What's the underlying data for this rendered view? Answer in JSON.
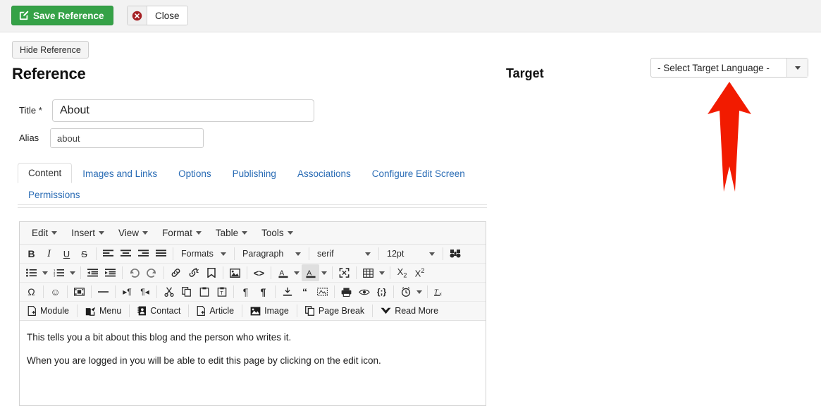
{
  "topbar": {
    "save_label": "Save Reference",
    "save_icon": "edit-square-icon",
    "close_label": "Close",
    "close_icon": "red-circle-x-icon",
    "save_color": "#35a247",
    "close_icon_color": "#a52024"
  },
  "hide_reference_label": "Hide Reference",
  "reference_heading": "Reference",
  "target_heading": "Target",
  "language_select": {
    "value": "- Select Target Language -",
    "caret_icon": "chevron-down-icon"
  },
  "annotation": {
    "arrow_icon": "up-arrow-annotation",
    "color": "#f21b00"
  },
  "form": {
    "title_label": "Title *",
    "title_value": "About",
    "title_placeholder": "Title",
    "alias_label": "Alias",
    "alias_value": "about",
    "alias_placeholder": "Alias"
  },
  "tabs": {
    "row1": [
      {
        "label": "Content",
        "active": true
      },
      {
        "label": "Images and Links",
        "active": false
      },
      {
        "label": "Options",
        "active": false
      },
      {
        "label": "Publishing",
        "active": false
      },
      {
        "label": "Associations",
        "active": false
      },
      {
        "label": "Configure Edit Screen",
        "active": false
      }
    ],
    "row2": [
      {
        "label": "Permissions",
        "active": false
      }
    ]
  },
  "editor": {
    "menubar": [
      {
        "label": "Edit"
      },
      {
        "label": "Insert"
      },
      {
        "label": "View"
      },
      {
        "label": "Format"
      },
      {
        "label": "Table"
      },
      {
        "label": "Tools"
      }
    ],
    "row1": {
      "buttons": [
        {
          "name": "bold-icon",
          "glyph": "B",
          "style": "bold"
        },
        {
          "name": "italic-icon",
          "glyph": "I",
          "style": "italic"
        },
        {
          "name": "underline-icon",
          "glyph": "U",
          "style": "underline"
        },
        {
          "name": "strikethrough-icon",
          "glyph": "S",
          "style": "strike"
        }
      ],
      "align": [
        {
          "name": "align-left-icon"
        },
        {
          "name": "align-center-icon"
        },
        {
          "name": "align-right-icon"
        },
        {
          "name": "align-justify-icon"
        }
      ],
      "formats_label": "Formats",
      "block_value": "Paragraph",
      "font_value": "serif",
      "size_value": "12pt",
      "last_icon": "binoculars-search-icon"
    },
    "row2_icons": [
      "bullet-list-icon",
      "numbered-list-icon",
      "outdent-icon",
      "indent-icon",
      "undo-icon",
      "redo-icon",
      "link-icon",
      "unlink-icon",
      "anchor-icon",
      "insert-image-icon",
      "source-code-icon",
      "text-color-icon",
      "background-color-icon",
      "fullscreen-icon",
      "table-icon",
      "subscript-icon",
      "superscript-icon"
    ],
    "row3_icons": [
      "special-character-icon",
      "emoticon-icon",
      "insert-video-icon",
      "horizontal-rule-icon",
      "ltr-icon",
      "rtl-icon",
      "cut-icon",
      "copy-icon",
      "paste-icon",
      "paste-text-icon",
      "show-blocks-icon",
      "visual-chars-icon",
      "template-icon",
      "blockquote-icon",
      "visual-aid-icon",
      "print-icon",
      "preview-icon",
      "code-sample-icon",
      "insert-datetime-icon",
      "clear-formatting-icon"
    ],
    "row4_buttons": [
      {
        "label": "Module",
        "icon": "module-icon"
      },
      {
        "label": "Menu",
        "icon": "menu-share-icon"
      },
      {
        "label": "Contact",
        "icon": "contact-card-icon"
      },
      {
        "label": "Article",
        "icon": "article-icon"
      },
      {
        "label": "Image",
        "icon": "image-icon"
      },
      {
        "label": "Page Break",
        "icon": "page-break-icon"
      },
      {
        "label": "Read More",
        "icon": "read-more-chevron-icon"
      }
    ],
    "content": {
      "paragraph1": "This tells you a bit about this blog and the person who writes it.",
      "paragraph2": "When you are logged in you will be able to edit this page by clicking on the edit icon."
    }
  }
}
